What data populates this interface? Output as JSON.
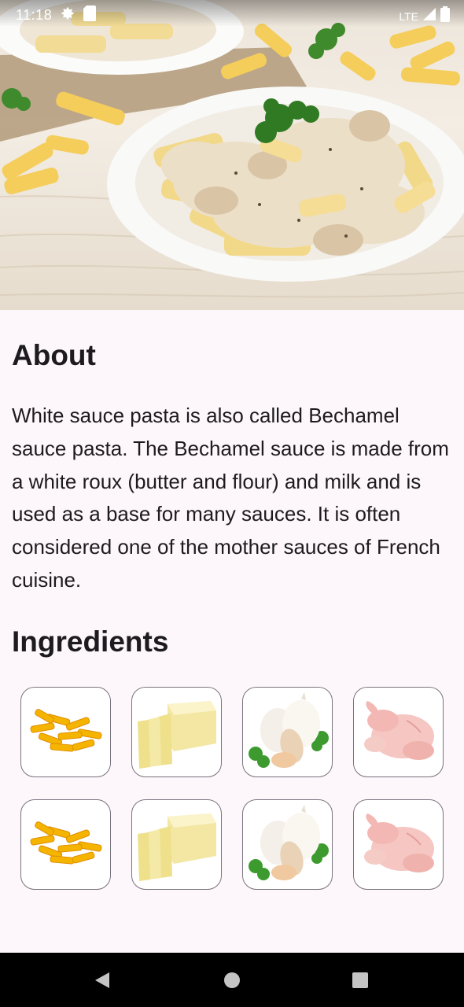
{
  "status_bar": {
    "time": "11:18",
    "network": "LTE"
  },
  "hero": {
    "icon": "pasta-dish-image"
  },
  "about": {
    "title": "About",
    "text": "White sauce pasta is also called Bechamel sauce pasta. The Bechamel sauce is made from a white roux (butter and flour) and milk and is used as a base for many sauces. It is often considered one of the mother sauces of French cuisine."
  },
  "ingredients": {
    "title": "Ingredients",
    "items": [
      {
        "icon": "penne-pasta"
      },
      {
        "icon": "butter"
      },
      {
        "icon": "garlic"
      },
      {
        "icon": "chicken"
      },
      {
        "icon": "penne-pasta"
      },
      {
        "icon": "butter"
      },
      {
        "icon": "garlic"
      },
      {
        "icon": "chicken"
      }
    ]
  },
  "nav_bar": {
    "back": "back-icon",
    "home": "home-icon",
    "recents": "recents-icon"
  }
}
